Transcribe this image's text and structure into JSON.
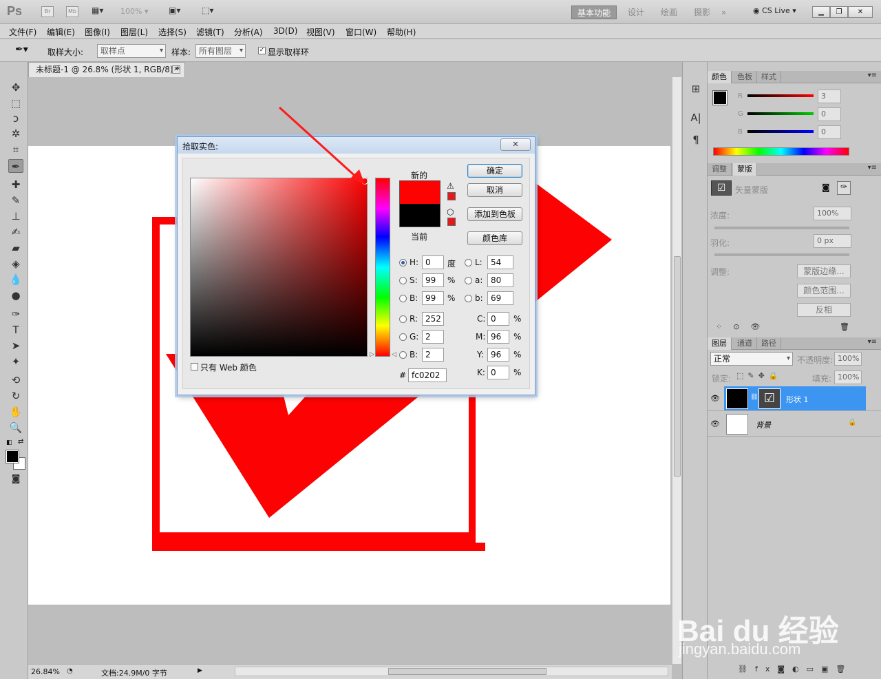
{
  "appbar": {
    "logo": "Ps",
    "br": "Br",
    "mb": "Mb",
    "zoom": "100%",
    "workspaces": [
      "基本功能",
      "设计",
      "绘画",
      "摄影"
    ],
    "more": "»",
    "cslive": "CS Live ▾"
  },
  "menu": [
    "文件(F)",
    "编辑(E)",
    "图像(I)",
    "图层(L)",
    "选择(S)",
    "滤镜(T)",
    "分析(A)",
    "3D(D)",
    "视图(V)",
    "窗口(W)",
    "帮助(H)"
  ],
  "options": {
    "sample_size_label": "取样大小:",
    "sample_size_value": "取样点",
    "sample_label": "样本:",
    "sample_value": "所有图层",
    "show_ring_label": "显示取样环"
  },
  "document": {
    "tab_title": "未标题-1 @ 26.8% (形状 1, RGB/8) *",
    "zoom": "26.84%",
    "doc_info": "文档:24.9M/0 字节"
  },
  "color_panel": {
    "tabs": [
      "颜色",
      "色板",
      "样式"
    ],
    "r_label": "R",
    "g_label": "G",
    "b_label": "B",
    "r": "3",
    "g": "0",
    "b": "0"
  },
  "adjust_panel": {
    "tabs": [
      "调整",
      "蒙版"
    ],
    "mask_type": "矢量蒙版",
    "density_label": "浓度:",
    "density": "100%",
    "feather_label": "羽化:",
    "feather": "0 px",
    "refine_label": "调整:",
    "btn_edge": "蒙版边缘...",
    "btn_range": "颜色范围...",
    "btn_invert": "反相"
  },
  "layers_panel": {
    "tabs": [
      "图层",
      "通道",
      "路径"
    ],
    "blend_mode": "正常",
    "opacity_label": "不透明度:",
    "opacity": "100%",
    "lock_label": "锁定:",
    "fill_label": "填充:",
    "fill": "100%",
    "layers": [
      {
        "name": "形状 1"
      },
      {
        "name": "背景"
      }
    ]
  },
  "dialog": {
    "title": "拾取实色:",
    "new_label": "新的",
    "current_label": "当前",
    "ok": "确定",
    "cancel": "取消",
    "add_swatch": "添加到色板",
    "color_lib": "颜色库",
    "web_only": "只有 Web 颜色",
    "h_label": "H:",
    "h": "0",
    "h_unit": "度",
    "s_label": "S:",
    "s": "99",
    "s_unit": "%",
    "bv_label": "B:",
    "bv": "99",
    "bv_unit": "%",
    "r_label": "R:",
    "r": "252",
    "g_label": "G:",
    "g": "2",
    "b_label": "B:",
    "b": "2",
    "l_label": "L:",
    "l": "54",
    "a_label": "a:",
    "a": "80",
    "lb_label": "b:",
    "lb": "69",
    "c_label": "C:",
    "c": "0",
    "m_label": "M:",
    "m": "96",
    "y_label": "Y:",
    "y": "96",
    "k_label": "K:",
    "k": "0",
    "pct": "%",
    "hash": "#",
    "hex": "fc0202",
    "new_color": "#fc0202",
    "current_color": "#000000"
  },
  "watermark": {
    "brand": "Bai du 经验",
    "url": "jingyan.baidu.com"
  }
}
